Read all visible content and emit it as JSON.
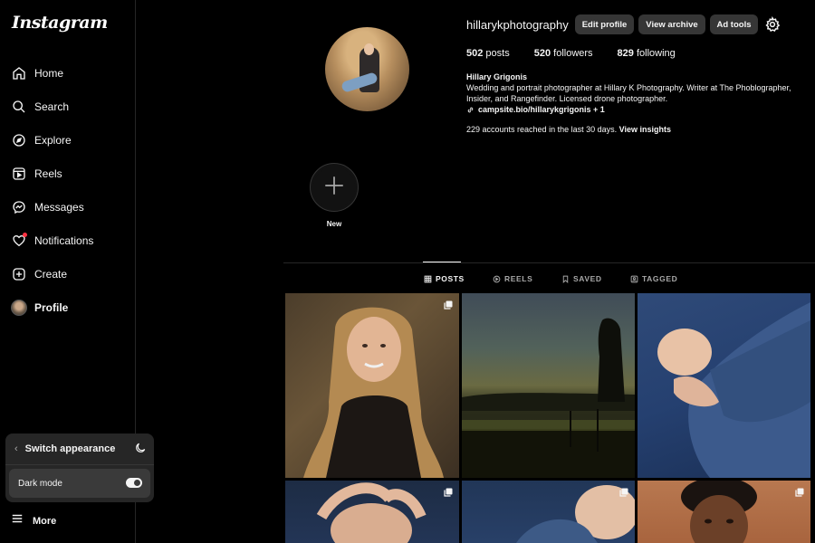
{
  "app": {
    "logo": "Instagram"
  },
  "sidebar": {
    "items": [
      {
        "label": "Home",
        "icon": "home-icon"
      },
      {
        "label": "Search",
        "icon": "search-icon"
      },
      {
        "label": "Explore",
        "icon": "compass-icon"
      },
      {
        "label": "Reels",
        "icon": "reels-icon"
      },
      {
        "label": "Messages",
        "icon": "messenger-icon"
      },
      {
        "label": "Notifications",
        "icon": "heart-icon"
      },
      {
        "label": "Create",
        "icon": "plus-square-icon"
      },
      {
        "label": "Profile",
        "icon": "avatar"
      }
    ],
    "more_label": "More"
  },
  "appearance": {
    "title": "Switch appearance",
    "dark_mode_label": "Dark mode",
    "dark_mode_on": true
  },
  "profile": {
    "username": "hillarykphotography",
    "buttons": {
      "edit": "Edit profile",
      "archive": "View archive",
      "ad_tools": "Ad tools"
    },
    "stats": {
      "posts_count": "502",
      "posts_label": "posts",
      "followers_count": "520",
      "followers_label": "followers",
      "following_count": "829",
      "following_label": "following"
    },
    "full_name": "Hillary Grigonis",
    "bio_line1": "Wedding and portrait photographer at Hillary K Photography. Writer at The Phoblographer,",
    "bio_line2": "Insider, and Rangefinder. Licensed drone photographer.",
    "link": "campsite.bio/hillarykgrigonis + 1",
    "reach_text": "229 accounts reached in the last 30 days.",
    "view_insights": "View insights"
  },
  "highlights": {
    "new_label": "New"
  },
  "tabs": [
    {
      "label": "POSTS",
      "icon": "grid-icon",
      "active": true
    },
    {
      "label": "REELS",
      "icon": "reels-icon",
      "active": false
    },
    {
      "label": "SAVED",
      "icon": "bookmark-icon",
      "active": false
    },
    {
      "label": "TAGGED",
      "icon": "tag-icon",
      "active": false
    }
  ],
  "colors": {
    "background": "#000000",
    "surface": "#262626",
    "button": "#363636",
    "text": "#f5f5f5",
    "muted": "#a8a8a8",
    "notification_dot": "#ff3040"
  }
}
